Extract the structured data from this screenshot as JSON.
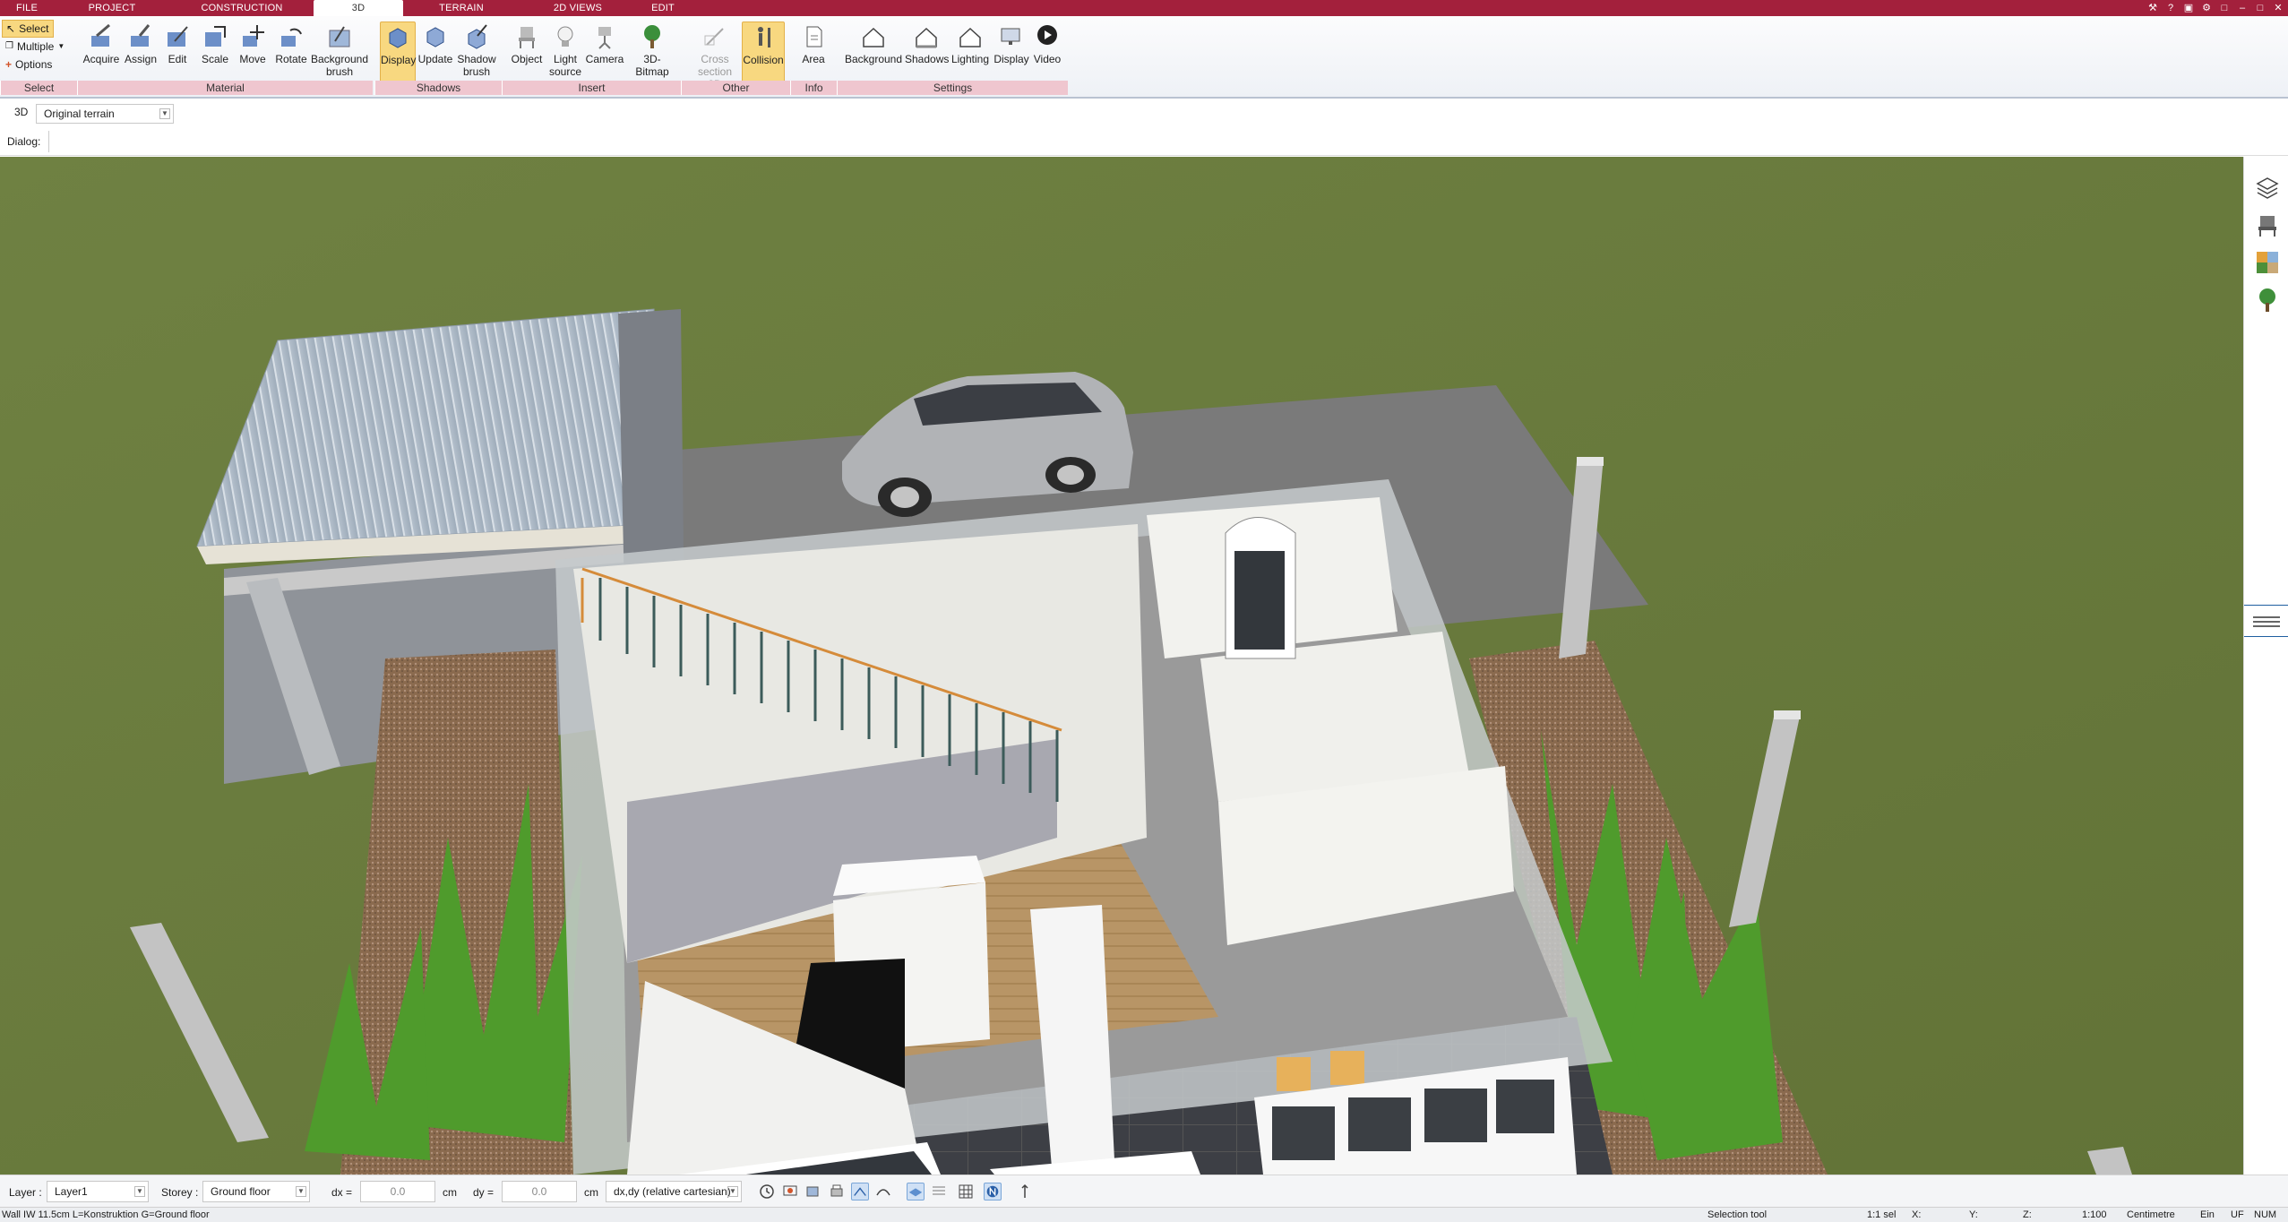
{
  "tabs": [
    {
      "label": "FILE",
      "active": false
    },
    {
      "label": "PROJECT",
      "active": false
    },
    {
      "label": "CONSTRUCTION",
      "active": false
    },
    {
      "label": "3D",
      "active": true
    },
    {
      "label": "TERRAIN",
      "active": false
    },
    {
      "label": "2D VIEWS",
      "active": false
    },
    {
      "label": "EDIT",
      "active": false
    }
  ],
  "ribbon": {
    "select": {
      "select_label": "Select",
      "multiple_label": "Multiple",
      "options_label": "Options",
      "group_label": "Select"
    },
    "material": {
      "acquire": "Acquire",
      "assign": "Assign",
      "edit": "Edit",
      "scale": "Scale",
      "move": "Move",
      "rotate": "Rotate",
      "background_brush": "Background brush",
      "group_label": "Material"
    },
    "shadows": {
      "display": "Display",
      "update": "Update",
      "shadow_brush": "Shadow brush",
      "group_label": "Shadows"
    },
    "insert": {
      "object": "Object",
      "light_source": "Light source",
      "camera": "Camera",
      "bitmap_3d": "3D-Bitmap",
      "group_label": "Insert"
    },
    "other": {
      "cross_section": "Cross section 3D",
      "collision": "Collision",
      "group_label": "Other"
    },
    "info": {
      "area": "Area",
      "group_label": "Info"
    },
    "settings": {
      "background": "Background",
      "shadows": "Shadows",
      "lighting": "Lighting",
      "display": "Display",
      "video": "Video",
      "group_label": "Settings"
    }
  },
  "viewbar": {
    "view_label": "3D",
    "terrain_value": "Original terrain"
  },
  "dialog": {
    "label": "Dialog:"
  },
  "bottom": {
    "layer_label": "Layer :",
    "layer_value": "Layer1",
    "storey_label": "Storey :",
    "storey_value": "Ground floor",
    "dx_label": "dx =",
    "dx_value": "0.0",
    "dx_unit": "cm",
    "dy_label": "dy =",
    "dy_value": "0.0",
    "dy_unit": "cm",
    "coord_mode": "dx,dy (relative cartesian)"
  },
  "status": {
    "element_info": "Wall IW 11.5cm L=Konstruktion G=Ground floor",
    "tool": "Selection tool",
    "selection": "1:1 sel",
    "x_label": "X:",
    "y_label": "Y:",
    "z_label": "Z:",
    "scale": "1:100",
    "unit": "Centimetre",
    "ein": "Ein",
    "uf": "UF",
    "num": "NUM"
  },
  "colors": {
    "accent": "#a3203c",
    "highlight": "#f8d880",
    "group_strip": "#efc6cf",
    "grass": "#6b7c3c"
  },
  "icons": [
    "layers-icon",
    "chair-icon",
    "material-palette-icon",
    "tree-icon"
  ]
}
